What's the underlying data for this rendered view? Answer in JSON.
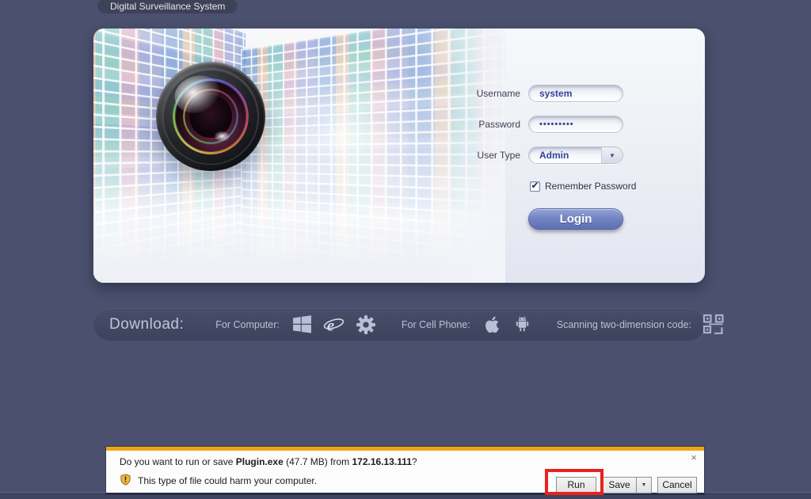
{
  "window": {
    "title_tab": "Digital Surveillance System"
  },
  "icons": {
    "dropdown": "▼",
    "check": "✔",
    "close": "×",
    "save_dropdown": "▼"
  },
  "login": {
    "username": {
      "label": "Username",
      "value": "system"
    },
    "password": {
      "label": "Password",
      "value": "•••••••••"
    },
    "user_type": {
      "label": "User Type",
      "value": "Admin"
    },
    "remember_label": "Remember Password",
    "login_button": "Login"
  },
  "download": {
    "title": "Download:",
    "for_computer_label": "For Computer:",
    "for_cell_phone_label": "For Cell Phone:",
    "qr_label": "Scanning two-dimension code:"
  },
  "notification": {
    "message_prefix": "Do you want to run or save ",
    "file_name": "Plugin.exe",
    "message_middle": " (47.7 MB) from ",
    "host": "172.16.13.111",
    "message_suffix": "?",
    "warning_text": "This type of file could harm your computer.",
    "buttons": {
      "run": "Run",
      "save": "Save",
      "cancel": "Cancel"
    }
  },
  "colors": {
    "background": "#4a506e",
    "accent_orange": "#f0a50f",
    "annotation_red": "#e8221c",
    "login_button_blue": "#7485c4"
  }
}
